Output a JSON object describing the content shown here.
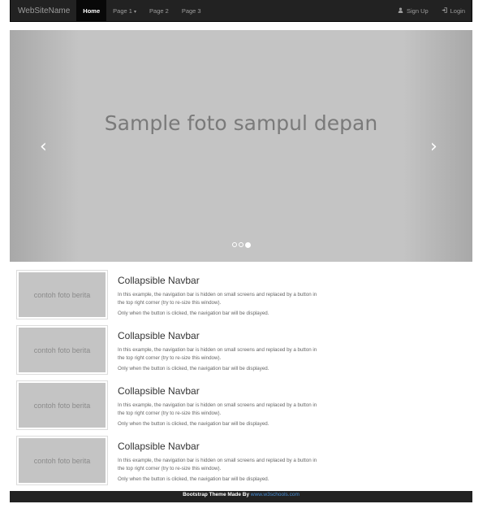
{
  "navbar": {
    "brand": "WebSiteName",
    "items": [
      {
        "label": "Home",
        "active": true
      },
      {
        "label": "Page 1",
        "dropdown": true
      },
      {
        "label": "Page 2"
      },
      {
        "label": "Page 3"
      }
    ],
    "right": [
      {
        "label": "Sign Up",
        "icon": "user-icon"
      },
      {
        "label": "Login",
        "icon": "login-icon"
      }
    ]
  },
  "carousel": {
    "caption": "Sample foto sampul depan",
    "slide_count": 3,
    "active_slide": 3
  },
  "news": [
    {
      "thumb_label": "contoh foto berita",
      "title": "Collapsible Navbar",
      "text1": "In this example, the navigation bar is hidden on small screens and replaced by a button in the top right corner (try to re-size this window).",
      "text2": "Only when the button is clicked, the navigation bar will be displayed."
    },
    {
      "thumb_label": "contoh foto berita",
      "title": "Collapsible Navbar",
      "text1": "In this example, the navigation bar is hidden on small screens and replaced by a button in the top right corner (try to re-size this window).",
      "text2": "Only when the button is clicked, the navigation bar will be displayed."
    },
    {
      "thumb_label": "contoh foto berita",
      "title": "Collapsible Navbar",
      "text1": "In this example, the navigation bar is hidden on small screens and replaced by a button in the top right corner (try to re-size this window).",
      "text2": "Only when the button is clicked, the navigation bar will be displayed."
    },
    {
      "thumb_label": "contoh foto berita",
      "title": "Collapsible Navbar",
      "text1": "In this example, the navigation bar is hidden on small screens and replaced by a button in the top right corner (try to re-size this window).",
      "text2": "Only when the button is clicked, the navigation bar will be displayed."
    }
  ],
  "footer": {
    "text": "Bootstrap Theme Made By ",
    "link": "www.w3schools.com"
  }
}
